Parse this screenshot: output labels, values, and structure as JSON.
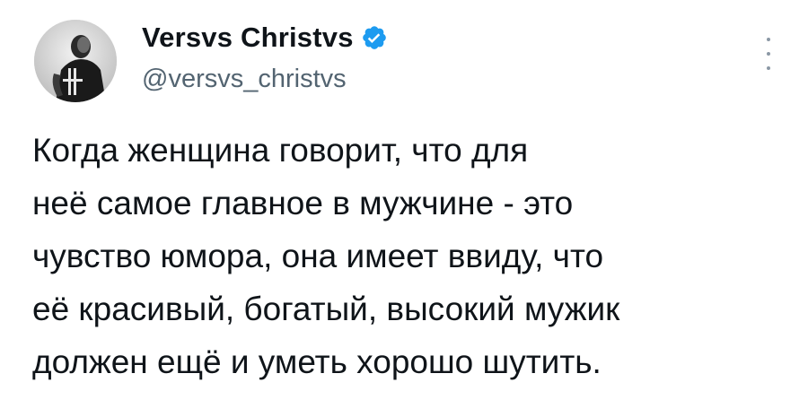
{
  "author": {
    "display_name": "Versvs Christvs",
    "handle": "@versvs_christvs",
    "verified": true,
    "avatar_icon": "profile-photo-avatar",
    "verified_icon": "verified-badge-icon",
    "verified_color": "#1d9bf0"
  },
  "tweet": {
    "text": "Когда женщина говорит, что для\nнеё самое главное в мужчине - это\nчувство юмора, она имеет ввиду, что\nеё красивый, богатый, высокий мужик\nдолжен ещё и уметь хорошо шутить."
  },
  "menu": {
    "icon": "more-vertical-icon"
  },
  "colors": {
    "text_primary": "#0f1419",
    "text_secondary": "#536471",
    "background": "#ffffff"
  }
}
